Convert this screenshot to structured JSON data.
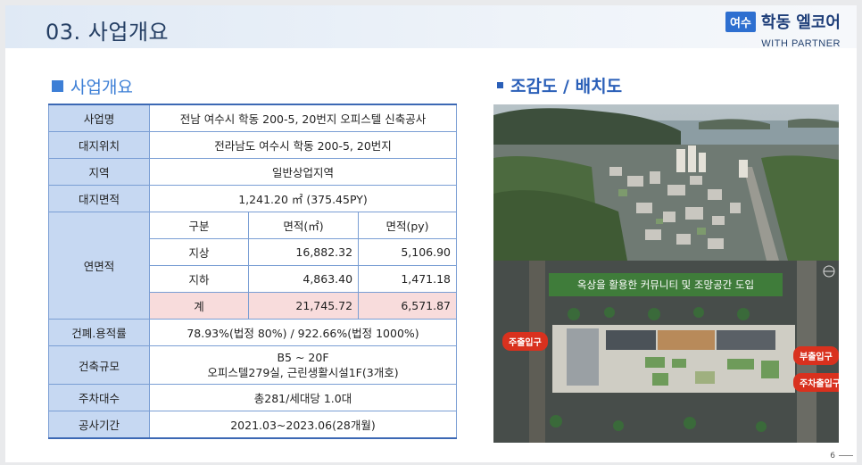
{
  "header": {
    "title": "03. 사업개요",
    "brand_badge": "여수",
    "brand_name": "학동 엘코어",
    "brand_sub": "WITH PARTNER"
  },
  "left_section": {
    "title": "사업개요",
    "rows": {
      "project_name": {
        "label": "사업명",
        "value": "전남 여수시 학동 200-5, 20번지 오피스텔 신축공사"
      },
      "site_location": {
        "label": "대지위치",
        "value": "전라남도 여수시 학동 200-5, 20번지"
      },
      "zone": {
        "label": "지역",
        "value": "일반상업지역"
      },
      "site_area": {
        "label": "대지면적",
        "value": "1,241.20 ㎡ (375.45PY)"
      },
      "floor_area": {
        "label": "연면적",
        "headers": [
          "구분",
          "면적(㎡)",
          "면적(py)"
        ],
        "rows": [
          {
            "name": "지상",
            "sqm": "16,882.32",
            "py": "5,106.90"
          },
          {
            "name": "지하",
            "sqm": "4,863.40",
            "py": "1,471.18"
          },
          {
            "name": "계",
            "sqm": "21,745.72",
            "py": "6,571.87"
          }
        ]
      },
      "coverage": {
        "label": "건폐.용적률",
        "value": "78.93%(법정 80%) / 922.66%(법정 1000%)"
      },
      "scale": {
        "label": "건축규모",
        "line1": "B5 ~ 20F",
        "line2": "오피스텔279실, 근린생활시설1F(3개호)"
      },
      "parking": {
        "label": "주차대수",
        "value": "총281/세대당 1.0대"
      },
      "period": {
        "label": "공사기간",
        "value": "2021.03~2023.06(28개월)"
      }
    }
  },
  "right_section": {
    "title": "조감도 / 배치도",
    "site_plan": {
      "banner": "옥상을 활용한 커뮤니티 및 조망공간 도입",
      "callouts": {
        "main_entrance": "주출입구",
        "side_entrance": "부출입구",
        "parking_entrance": "주차출입구"
      }
    }
  },
  "footer": {
    "page_number": "6"
  }
}
